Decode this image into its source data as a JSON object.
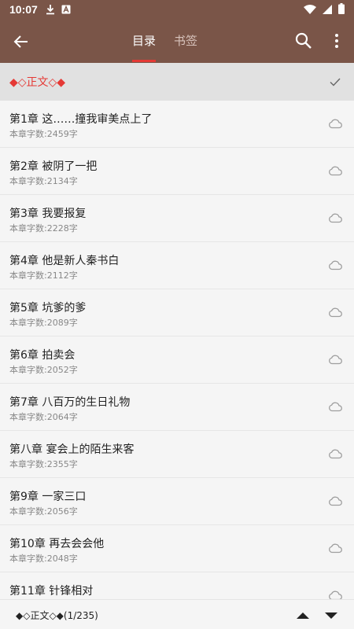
{
  "status_bar": {
    "time": "10:07"
  },
  "toolbar": {
    "tab_toc": "目录",
    "tab_bookmark": "书签"
  },
  "volume": {
    "title": "◆◇正文◇◆"
  },
  "chapters": [
    {
      "title": "第1章 这……撞我审美点上了",
      "count": "本章字数:2459字"
    },
    {
      "title": "第2章 被阴了一把",
      "count": "本章字数:2134字"
    },
    {
      "title": "第3章 我要报复",
      "count": "本章字数:2228字"
    },
    {
      "title": "第4章 他是新人秦书白",
      "count": "本章字数:2112字"
    },
    {
      "title": "第5章 坑爹的爹",
      "count": "本章字数:2089字"
    },
    {
      "title": "第6章 拍卖会",
      "count": "本章字数:2052字"
    },
    {
      "title": "第7章 八百万的生日礼物",
      "count": "本章字数:2064字"
    },
    {
      "title": "第八章 宴会上的陌生来客",
      "count": "本章字数:2355字"
    },
    {
      "title": "第9章 一家三口",
      "count": "本章字数:2056字"
    },
    {
      "title": "第10章 再去会会他",
      "count": "本章字数:2048字"
    },
    {
      "title": "第11章 针锋相对",
      "count": ""
    }
  ],
  "bottom_bar": {
    "progress": "◆◇正文◇◆(1/235)"
  },
  "icons": {
    "back": "arrow-left-icon",
    "search": "search-icon",
    "more": "more-vertical-icon",
    "check": "check-icon",
    "cloud": "cloud-icon",
    "up": "triangle-up-icon",
    "down": "triangle-down-icon"
  },
  "colors": {
    "toolbar": "#7a5548",
    "accent": "#e53935",
    "volume_row": "#e1e1e1",
    "background": "#f5f5f5"
  }
}
